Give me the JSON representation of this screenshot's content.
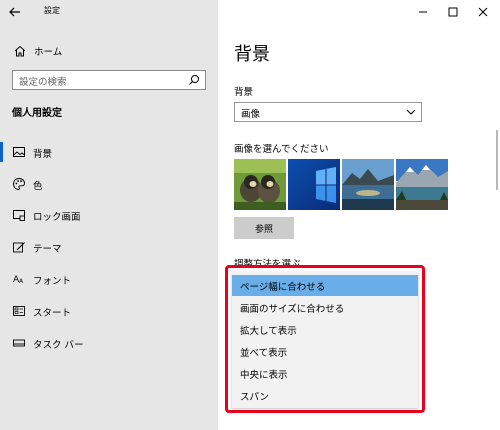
{
  "window": {
    "title": "設定"
  },
  "sidebar": {
    "home_label": "ホーム",
    "search_placeholder": "設定の検索",
    "section_title": "個人用設定",
    "items": [
      {
        "label": "背景",
        "icon": "picture-icon",
        "selected": true
      },
      {
        "label": "色",
        "icon": "palette-icon",
        "selected": false
      },
      {
        "label": "ロック画面",
        "icon": "lock-screen-icon",
        "selected": false
      },
      {
        "label": "テーマ",
        "icon": "theme-brush-icon",
        "selected": false
      },
      {
        "label": "フォント",
        "icon": "font-icon",
        "selected": false
      },
      {
        "label": "スタート",
        "icon": "start-icon",
        "selected": false
      },
      {
        "label": "タスク バー",
        "icon": "taskbar-icon",
        "selected": false
      }
    ]
  },
  "main": {
    "page_title": "背景",
    "background_label": "背景",
    "background_value": "画像",
    "choose_label": "画像を選んでください",
    "thumbnails": [
      "ducklings",
      "windows-blue",
      "lake-sunset",
      "mountain-lake"
    ],
    "browse_label": "参照",
    "fit_label": "調整方法を選ぶ",
    "fit_options": [
      {
        "label": "ページ幅に合わせる",
        "selected": true
      },
      {
        "label": "画面のサイズに合わせる",
        "selected": false
      },
      {
        "label": "拡大して表示",
        "selected": false
      },
      {
        "label": "並べて表示",
        "selected": false
      },
      {
        "label": "中央に表示",
        "selected": false
      },
      {
        "label": "スパン",
        "selected": false
      }
    ]
  },
  "colors": {
    "sidebar_bg": "#e6e6e6",
    "accent": "#0a64c8",
    "selection": "#69aee9",
    "highlight": "#e8001c"
  }
}
